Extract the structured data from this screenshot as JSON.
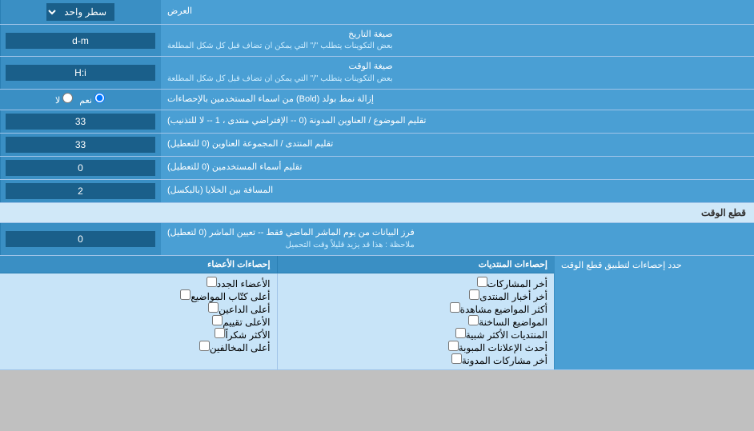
{
  "header": {
    "title": "العرض",
    "dropdown_label": "سطر واحد"
  },
  "rows": [
    {
      "id": "date_format",
      "label": "صيغة التاريخ",
      "sublabel": "بعض التكوينات يتطلب \"/\" التي يمكن ان تضاف قبل كل شكل المطلعة",
      "value": "d-m",
      "type": "text"
    },
    {
      "id": "time_format",
      "label": "صيغة الوقت",
      "sublabel": "بعض التكوينات يتطلب \"/\" التي يمكن ان تضاف قبل كل شكل المطلعة",
      "value": "H:i",
      "type": "text"
    },
    {
      "id": "bold_remove",
      "label": "إزالة نمط بولد (Bold) من اسماء المستخدمين بالإحصاءات",
      "type": "radio",
      "options": [
        "نعم",
        "لا"
      ],
      "selected": "نعم"
    },
    {
      "id": "subject_count",
      "label": "تقليم الموضوع / العناوين المدونة (0 -- الإفتراضي منتدى ، 1 -- لا للتذنيب)",
      "value": "33",
      "type": "text"
    },
    {
      "id": "forum_headers",
      "label": "تقليم المنتدى / المجموعة العناوين (0 للتعطيل)",
      "value": "33",
      "type": "text"
    },
    {
      "id": "usernames_trim",
      "label": "تقليم أسماء المستخدمين (0 للتعطيل)",
      "value": "0",
      "type": "text"
    },
    {
      "id": "cell_spacing",
      "label": "المسافة بين الخلايا (بالبكسل)",
      "value": "2",
      "type": "text"
    }
  ],
  "cutoff_section": {
    "title": "قطع الوقت",
    "row": {
      "label": "فرز البيانات من يوم الماشر الماضي فقط -- تعيين الماشر (0 لتعطيل)",
      "sublabel": "ملاحظة : هذا قد يزيد قليلاً وقت التحميل",
      "value": "0",
      "type": "text"
    },
    "stats_label": "حدد إحصاءات لتطبيق قطع الوقت"
  },
  "checkboxes": {
    "col1_header": "إحصاءات المنتديات",
    "col2_header": "إحصاءات الأعضاء",
    "col1_items": [
      {
        "label": "أخر المشاركات",
        "checked": false
      },
      {
        "label": "أخر أخبار المنتدى",
        "checked": false
      },
      {
        "label": "أكثر المواضيع مشاهدة",
        "checked": false
      },
      {
        "label": "المواضيع الساخنة",
        "checked": false
      },
      {
        "label": "المنتديات الأكثر شبية",
        "checked": false
      },
      {
        "label": "أحدث الإعلانات المبوبة",
        "checked": false
      },
      {
        "label": "أخر مشاركات المدونة",
        "checked": false
      }
    ],
    "col2_items": [
      {
        "label": "الأعضاء الجدد",
        "checked": false
      },
      {
        "label": "أعلى كتّاب المواضيع",
        "checked": false
      },
      {
        "label": "أعلى الداعين",
        "checked": false
      },
      {
        "label": "الأعلى تقييم",
        "checked": false
      },
      {
        "label": "الأكثر شكراً",
        "checked": false
      },
      {
        "label": "أعلى المخالفين",
        "checked": false
      }
    ]
  }
}
